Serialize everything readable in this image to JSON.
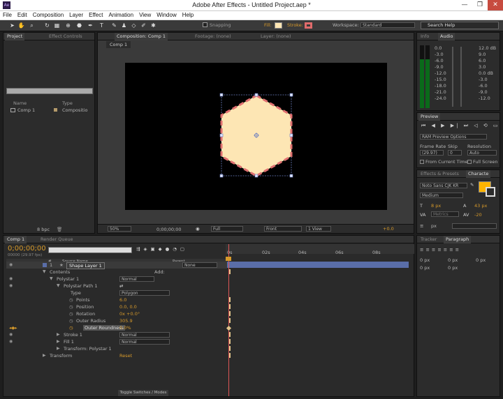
{
  "window": {
    "title": "Adobe After Effects - Untitled Project.aep *",
    "icon": "Ae",
    "min": "—",
    "max": "❐",
    "close": "✕"
  },
  "menu": [
    "File",
    "Edit",
    "Composition",
    "Layer",
    "Effect",
    "Animation",
    "View",
    "Window",
    "Help"
  ],
  "toolbar": {
    "snapping": "Snapping",
    "fill": "Fill:",
    "stroke": "Stroke:",
    "workspace_label": "Workspace:",
    "workspace": "Standard",
    "search": "Search Help",
    "fill_color": "#fde6b4",
    "stroke_color": "#e06b6b"
  },
  "project": {
    "tab_project": "Project",
    "tab_effect": "Effect Controls",
    "col_name": "Name",
    "col_type": "Type",
    "item_name": "Comp 1",
    "item_type": "Compositio",
    "bpc": "8 bpc"
  },
  "viewer": {
    "tab_comp": "Composition: Comp 1",
    "tab_footage": "Footage: (none)",
    "tab_layer": "Layer: (none)",
    "crumb": "Comp 1",
    "zoom": "50%",
    "timecode": "0;00;00;00",
    "resolution": "Full",
    "view": "Front",
    "views": "1 View",
    "exposure": "+0.0",
    "hexagon_fill": "#fde6b4",
    "hexagon_stroke": "#e07070"
  },
  "info": {
    "tab_info": "Info",
    "tab_audio": "Audio",
    "left_scale": [
      "0.0",
      "-3.0",
      "-6.0",
      "-9.0",
      "-12.0",
      "-15.0",
      "-18.0",
      "-21.0",
      "-24.0"
    ],
    "right_scale": [
      "12.0 dB",
      "9.0",
      "6.0",
      "3.0",
      "0.0 dB",
      "-3.0",
      "-6.0",
      "-9.0",
      "-12.0"
    ]
  },
  "preview": {
    "tab": "Preview",
    "ram": "RAM Preview Options",
    "frame_rate_label": "Frame Rate",
    "skip_label": "Skip",
    "resolution_label": "Resolution",
    "frame_rate": "(29.97)",
    "skip": "0",
    "resolution": "Auto",
    "from_current": "From Current Time",
    "full_screen": "Full Screen"
  },
  "effects": {
    "tab": "Effects & Presets",
    "tab_char": "Characte"
  },
  "character": {
    "font": "Noto Sans CJK KR",
    "weight": "Medium",
    "size": "8 px",
    "leading": "43 px",
    "tracking": "-20",
    "kerning": "Metrics",
    "indent": "px",
    "color": "#ffb400"
  },
  "tracker": {
    "tab": "Tracker",
    "tab_para": "Paragraph",
    "vals": [
      "0 px",
      "0 px",
      "0 px",
      "0 px",
      "0 px"
    ]
  },
  "timeline": {
    "tab_comp": "Comp 1",
    "tab_render": "Render Queue",
    "time": "0;00;00;00",
    "fps": "00000 (29.97 fps)",
    "col_num": "#",
    "col_source": "Source Name",
    "col_parent": "Parent",
    "ruler": [
      "0s",
      "02s",
      "04s",
      "06s",
      "08s"
    ],
    "toggle": "Toggle Switches / Modes",
    "rows": [
      {
        "num": "1",
        "name": "Shape Layer 1",
        "mode": "",
        "parent": "None"
      },
      {
        "name": "Contents",
        "add": "Add:"
      },
      {
        "name": "Polystar 1",
        "mode": "Normal"
      },
      {
        "name": "Polystar Path 1"
      },
      {
        "name": "Type",
        "value": "Polygon"
      },
      {
        "name": "Points",
        "value": "6.0"
      },
      {
        "name": "Position",
        "value": "0.0, 0.0"
      },
      {
        "name": "Rotation",
        "value": "0x +0.0°"
      },
      {
        "name": "Outer Radius",
        "value": "305.9"
      },
      {
        "name": "Outer Roundness",
        "value": "0.0%"
      },
      {
        "name": "Stroke 1",
        "mode": "Normal"
      },
      {
        "name": "Fill 1",
        "mode": "Normal"
      },
      {
        "name": "Transform: Polystar 1"
      },
      {
        "name": "Transform",
        "value": "Reset"
      }
    ]
  }
}
